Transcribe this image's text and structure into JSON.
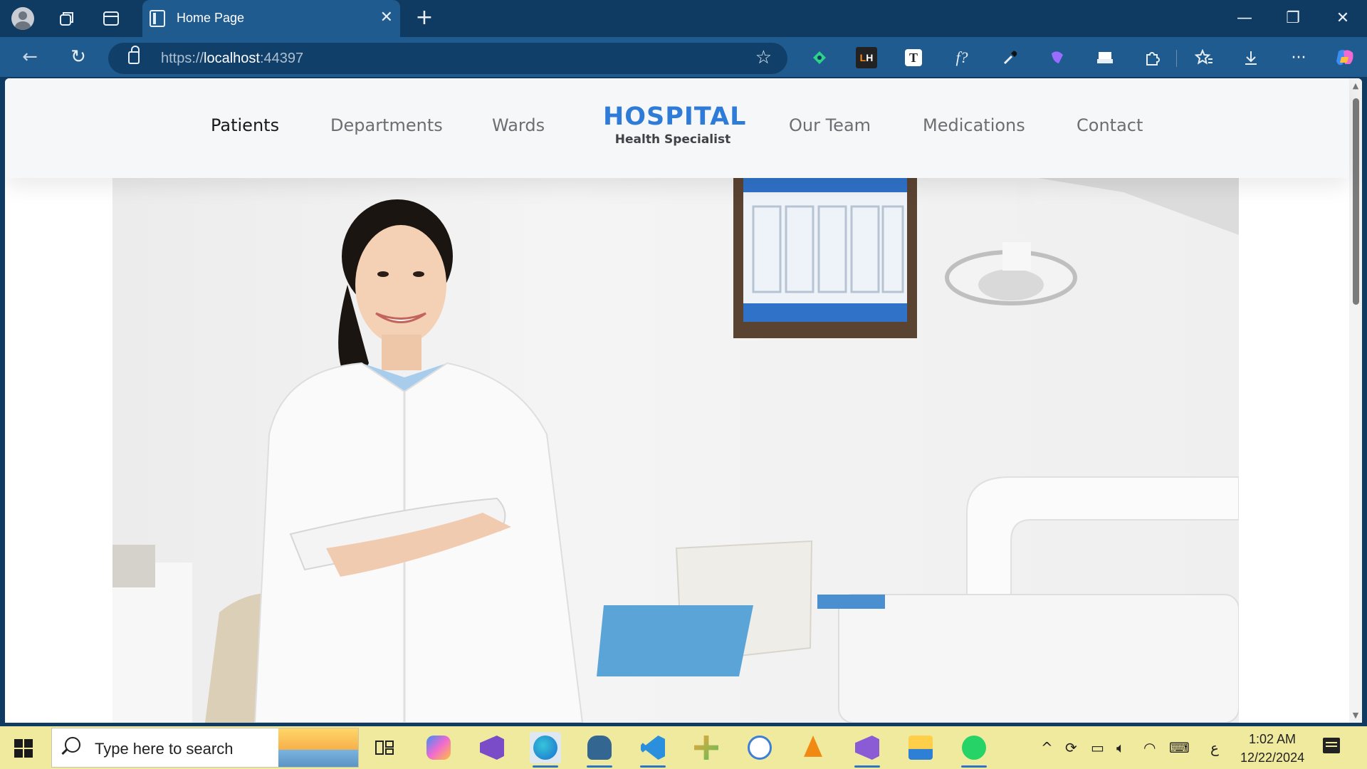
{
  "browser": {
    "tab_title": "Home Page",
    "url_scheme": "https://",
    "url_host": "localhost",
    "url_port": ":44397"
  },
  "site": {
    "nav_left": [
      "Patients",
      "Departments",
      "Wards"
    ],
    "brand_name": "HOSPITAL",
    "brand_tagline": "Health Specialist",
    "nav_right": [
      "Our Team",
      "Medications",
      "Contact"
    ],
    "active_nav": "Patients",
    "brand_color": "#2f7cd8"
  },
  "taskbar": {
    "search_placeholder": "Type here to search",
    "time": "1:02 AM",
    "date": "12/22/2024",
    "ime_indicator": "ع",
    "accent_color": "#f0ea9f"
  }
}
